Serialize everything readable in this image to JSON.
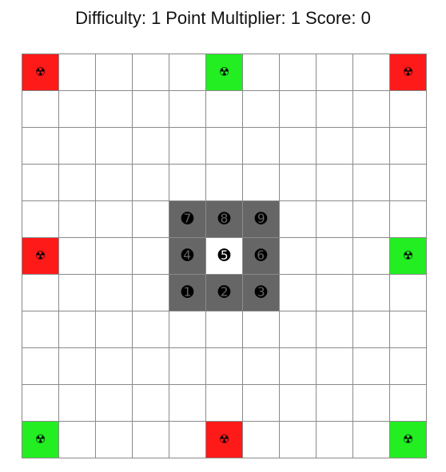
{
  "status": {
    "difficulty_text": "Difficulty: 1",
    "multiplier_text": "Point Multiplier: 1",
    "score_text": "Score: 0"
  },
  "board": {
    "rows": 11,
    "cols": 11,
    "colors": {
      "red": "#ff1a1a",
      "green": "#22ee22",
      "move_zone": "#666666",
      "empty": "#ffffff",
      "grid_line": "#8a8a8a"
    },
    "hazard_icon": "radioactive-icon",
    "hazard_glyph": "☢",
    "hazards": [
      {
        "row": 0,
        "col": 0,
        "color": "red"
      },
      {
        "row": 0,
        "col": 5,
        "color": "green"
      },
      {
        "row": 0,
        "col": 10,
        "color": "red"
      },
      {
        "row": 5,
        "col": 0,
        "color": "red"
      },
      {
        "row": 5,
        "col": 10,
        "color": "green"
      },
      {
        "row": 10,
        "col": 0,
        "color": "green"
      },
      {
        "row": 10,
        "col": 5,
        "color": "red"
      },
      {
        "row": 10,
        "col": 10,
        "color": "green"
      }
    ],
    "player": {
      "row": 5,
      "col": 5,
      "key": "5",
      "glyph": "➎"
    },
    "move_keys": [
      {
        "row": 4,
        "col": 4,
        "key": "7",
        "glyph": "➐"
      },
      {
        "row": 4,
        "col": 5,
        "key": "8",
        "glyph": "➑"
      },
      {
        "row": 4,
        "col": 6,
        "key": "9",
        "glyph": "➒"
      },
      {
        "row": 5,
        "col": 4,
        "key": "4",
        "glyph": "➍"
      },
      {
        "row": 5,
        "col": 6,
        "key": "6",
        "glyph": "➏"
      },
      {
        "row": 6,
        "col": 4,
        "key": "1",
        "glyph": "➊"
      },
      {
        "row": 6,
        "col": 5,
        "key": "2",
        "glyph": "➋"
      },
      {
        "row": 6,
        "col": 6,
        "key": "3",
        "glyph": "➌"
      }
    ]
  }
}
